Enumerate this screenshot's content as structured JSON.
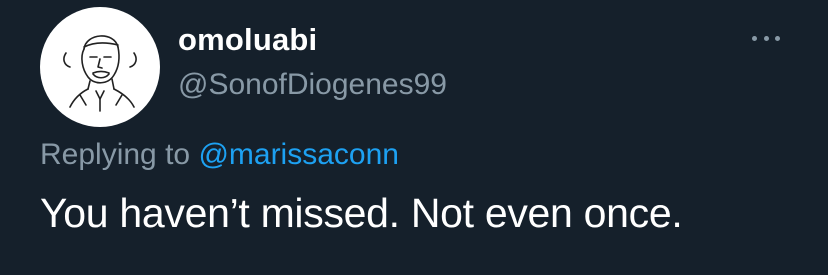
{
  "tweet": {
    "author": {
      "display_name": "omoluabi",
      "handle": "@SonofDiogenes99",
      "avatar_icon": "sketch-portrait-avatar"
    },
    "more_icon": "more-horizontal-icon",
    "reply": {
      "prefix": "Replying to ",
      "mention": "@marissaconn"
    },
    "text": "You haven’t missed. Not even once."
  },
  "colors": {
    "background": "#15202b",
    "primary_text": "#ffffff",
    "secondary_text": "#8899a6",
    "accent": "#1da1f2"
  }
}
